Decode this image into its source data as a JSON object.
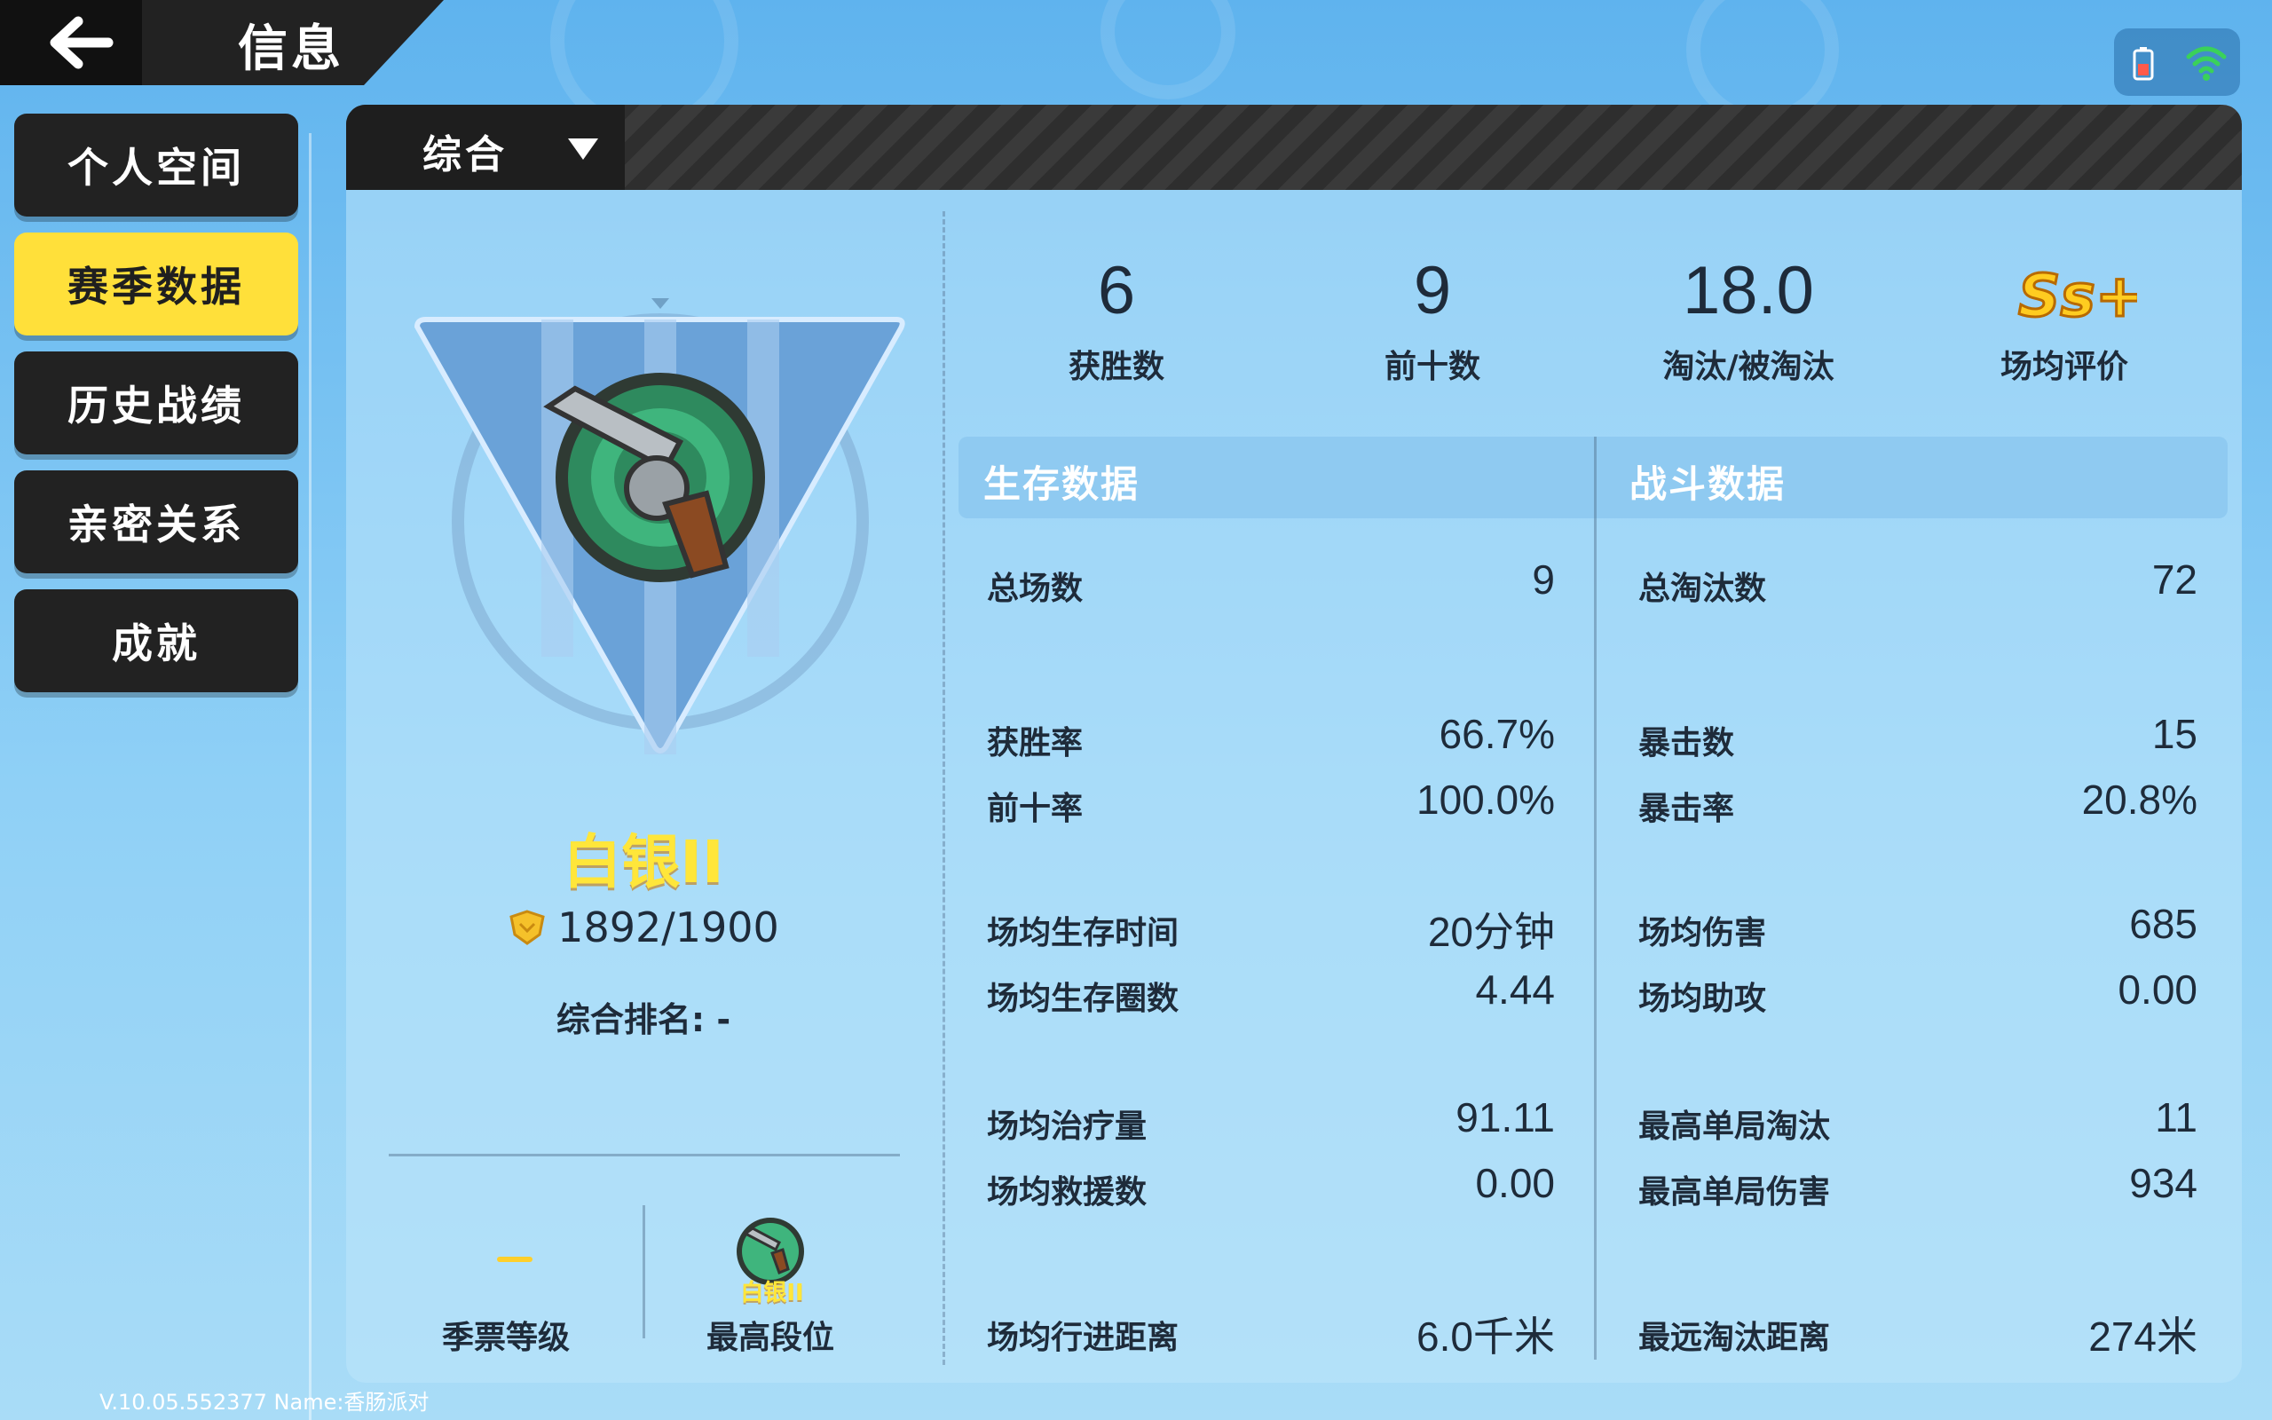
{
  "header": {
    "title": "信息"
  },
  "sidebar": {
    "items": [
      {
        "label": "个人空间",
        "active": false
      },
      {
        "label": "赛季数据",
        "active": true
      },
      {
        "label": "历史战绩",
        "active": false
      },
      {
        "label": "亲密关系",
        "active": false
      },
      {
        "label": "成就",
        "active": false
      }
    ]
  },
  "mode_dropdown": {
    "selected": "综合"
  },
  "rank": {
    "name": "白银II",
    "points": "1892/1900",
    "standing": "综合排名: -"
  },
  "bottom_info": {
    "season_pass_label": "季票等级",
    "season_pass_value": "-",
    "best_rank_label": "最高段位",
    "best_rank_name": "白银II"
  },
  "summary": {
    "wins": {
      "value": "6",
      "label": "获胜数"
    },
    "top10": {
      "value": "9",
      "label": "前十数"
    },
    "kd": {
      "value": "18.0",
      "label": "淘汰/被淘汰"
    },
    "avg_rating": {
      "value": "Ss+",
      "label": "场均评价"
    }
  },
  "survival": {
    "title": "生存数据",
    "rows": [
      {
        "label": "总场数",
        "value": "9"
      },
      {
        "label": "获胜率",
        "value": "66.7%"
      },
      {
        "label": "前十率",
        "value": "100.0%"
      },
      {
        "label": "场均生存时间",
        "value": "20分钟"
      },
      {
        "label": "场均生存圈数",
        "value": "4.44"
      },
      {
        "label": "场均治疗量",
        "value": "91.11"
      },
      {
        "label": "场均救援数",
        "value": "0.00"
      },
      {
        "label": "场均行进距离",
        "value": "6.0千米"
      }
    ]
  },
  "combat": {
    "title": "战斗数据",
    "rows": [
      {
        "label": "总淘汰数",
        "value": "72"
      },
      {
        "label": "暴击数",
        "value": "15"
      },
      {
        "label": "暴击率",
        "value": "20.8%"
      },
      {
        "label": "场均伤害",
        "value": "685"
      },
      {
        "label": "场均助攻",
        "value": "0.00"
      },
      {
        "label": "最高单局淘汰",
        "value": "11"
      },
      {
        "label": "最高单局伤害",
        "value": "934"
      },
      {
        "label": "最远淘汰距离",
        "value": "274米"
      }
    ]
  },
  "version": "V.10.05.552377 Name:香肠派对",
  "colors": {
    "accent_yellow": "#ffe03a",
    "dark": "#222222",
    "rank_gold": "#ffe63a"
  }
}
